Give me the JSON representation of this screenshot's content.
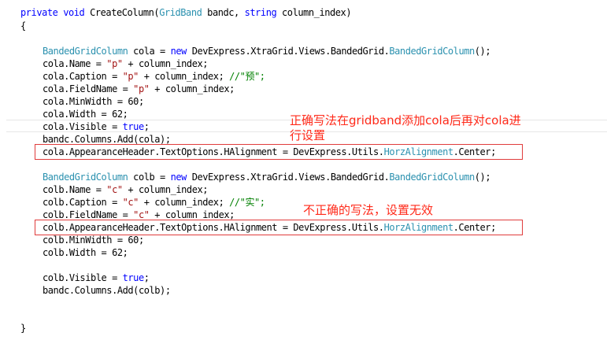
{
  "code": {
    "l1": {
      "kw1": "private",
      "kw2": "void",
      "name": "CreateColumn(",
      "ty": "GridBand",
      "mid": " bandc, ",
      "kw3": "string",
      "rest": " column_index)"
    },
    "l2": "{",
    "a1": {
      "ty1": "BandedGridColumn",
      "mid1": " cola = ",
      "kw": "new",
      "mid2": " DevExpress.XtraGrid.Views.BandedGrid.",
      "ty2": "BandedGridColumn",
      "end": "();"
    },
    "a2": {
      "pre": "cola.Name = ",
      "str": "\"p\"",
      "post": " + column_index;"
    },
    "a3": {
      "pre": "cola.Caption = ",
      "str": "\"p\"",
      "post": " + column_index; ",
      "cm": "//\"预\";"
    },
    "a4": {
      "pre": "cola.FieldName = ",
      "str": "\"p\"",
      "post": " + column_index;"
    },
    "a5": "cola.MinWidth = 60;",
    "a6": "cola.Width = 62;",
    "a7": {
      "pre": "cola.Visible = ",
      "kw": "true",
      "post": ";"
    },
    "a8": "bandc.Columns.Add(cola);",
    "a9": {
      "pre": "cola.AppearanceHeader.TextOptions.HAlignment = DevExpress.Utils.",
      "ty": "HorzAlignment",
      "post": ".Center;"
    },
    "b1": {
      "ty1": "BandedGridColumn",
      "mid1": " colb = ",
      "kw": "new",
      "mid2": " DevExpress.XtraGrid.Views.BandedGrid.",
      "ty2": "BandedGridColumn",
      "end": "();"
    },
    "b2": {
      "pre": "colb.Name = ",
      "str": "\"c\"",
      "post": " + column_index;"
    },
    "b3": {
      "pre": "colb.Caption = ",
      "str": "\"c\"",
      "post": " + column_index; ",
      "cm": "//\"实\";"
    },
    "b4": {
      "pre": "colb.FieldName = ",
      "str": "\"c\"",
      "post": " + column_index;"
    },
    "b5": {
      "pre": "colb.AppearanceHeader.TextOptions.HAlignment = DevExpress.Utils.",
      "ty": "HorzAlignment",
      "post": ".Center;"
    },
    "b6": "colb.MinWidth = 60;",
    "b7": "colb.Width = 62;",
    "b8": {
      "pre": "colb.Visible = ",
      "kw": "true",
      "post": ";"
    },
    "b9": "bandc.Columns.Add(colb);",
    "end": "}"
  },
  "annotations": {
    "correct_line1": "正确写法在gridband添加cola后再对cola进",
    "correct_line2": "行设置",
    "incorrect": "不正确的写法，设置无效"
  },
  "colors": {
    "keyword": "#0000ff",
    "type": "#2b91af",
    "string": "#a31515",
    "comment": "#008000",
    "annotation": "#ff2a1a",
    "box": "#e03c3c"
  }
}
